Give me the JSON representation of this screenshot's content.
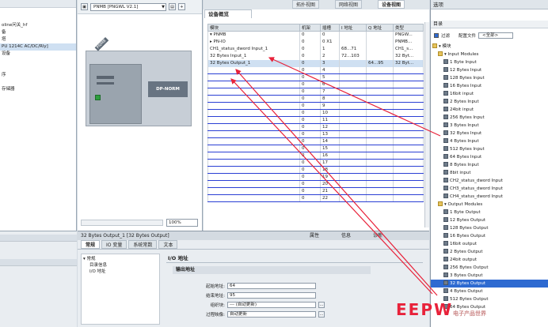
{
  "top_tabs": [
    "拓扑视图",
    "网络视图",
    "设备视图"
  ],
  "catalog_header": "选项",
  "left_tree": {
    "rows": [
      "oline问关_hf",
      "备",
      "塔",
      "PU 1214C AC/DC/Rly]",
      "设备",
      "",
      "",
      "序",
      "",
      "存储器"
    ],
    "selected_index": 3
  },
  "device_view": {
    "device_select": "PNMB [PNGWL V2.1]",
    "module_tag": "PNMB",
    "dp_label": "DP-NORM",
    "zoom": "100%"
  },
  "overview": {
    "title": "设备概览",
    "columns": [
      "模块",
      "机架",
      "插槽",
      "I 地址",
      "Q 地址",
      "类型"
    ],
    "rows": [
      {
        "module": "▾ PNMB",
        "rack": "0",
        "slot": "0",
        "i": "",
        "q": "",
        "type": "PNGW..."
      },
      {
        "module": "  ▸ PN-IO",
        "rack": "0",
        "slot": "0 X1",
        "i": "",
        "q": "",
        "type": "PNMB..."
      },
      {
        "module": "CH1_status_dword Input_1",
        "rack": "0",
        "slot": "1",
        "i": "68...71",
        "q": "",
        "type": "CH1_s..."
      },
      {
        "module": "32 Bytes Input_1",
        "rack": "0",
        "slot": "2",
        "i": "72...103",
        "q": "",
        "type": "32 Byt..."
      },
      {
        "module": "32 Bytes Output_1",
        "rack": "0",
        "slot": "3",
        "i": "",
        "q": "64...95",
        "type": "32 Byt..."
      },
      {
        "module": "",
        "rack": "0",
        "slot": "4",
        "i": "",
        "q": "",
        "type": ""
      },
      {
        "module": "",
        "rack": "0",
        "slot": "5",
        "i": "",
        "q": "",
        "type": ""
      },
      {
        "module": "",
        "rack": "0",
        "slot": "6",
        "i": "",
        "q": "",
        "type": ""
      },
      {
        "module": "",
        "rack": "0",
        "slot": "7",
        "i": "",
        "q": "",
        "type": ""
      },
      {
        "module": "",
        "rack": "0",
        "slot": "8",
        "i": "",
        "q": "",
        "type": ""
      },
      {
        "module": "",
        "rack": "0",
        "slot": "9",
        "i": "",
        "q": "",
        "type": ""
      },
      {
        "module": "",
        "rack": "0",
        "slot": "10",
        "i": "",
        "q": "",
        "type": ""
      },
      {
        "module": "",
        "rack": "0",
        "slot": "11",
        "i": "",
        "q": "",
        "type": ""
      },
      {
        "module": "",
        "rack": "0",
        "slot": "12",
        "i": "",
        "q": "",
        "type": ""
      },
      {
        "module": "",
        "rack": "0",
        "slot": "13",
        "i": "",
        "q": "",
        "type": ""
      },
      {
        "module": "",
        "rack": "0",
        "slot": "14",
        "i": "",
        "q": "",
        "type": ""
      },
      {
        "module": "",
        "rack": "0",
        "slot": "15",
        "i": "",
        "q": "",
        "type": ""
      },
      {
        "module": "",
        "rack": "0",
        "slot": "16",
        "i": "",
        "q": "",
        "type": ""
      },
      {
        "module": "",
        "rack": "0",
        "slot": "17",
        "i": "",
        "q": "",
        "type": ""
      },
      {
        "module": "",
        "rack": "0",
        "slot": "18",
        "i": "",
        "q": "",
        "type": ""
      },
      {
        "module": "",
        "rack": "0",
        "slot": "19",
        "i": "",
        "q": "",
        "type": ""
      },
      {
        "module": "",
        "rack": "0",
        "slot": "20",
        "i": "",
        "q": "",
        "type": ""
      },
      {
        "module": "",
        "rack": "0",
        "slot": "21",
        "i": "",
        "q": "",
        "type": ""
      },
      {
        "module": "",
        "rack": "0",
        "slot": "22",
        "i": "",
        "q": "",
        "type": ""
      }
    ],
    "selected_index": 4
  },
  "properties": {
    "title": "32 Bytes Output_1 [32 Bytes Output]",
    "right_tabs": [
      "属性",
      "信息",
      "诊断"
    ],
    "tabs": [
      "常规",
      "IO 变量",
      "系统常数",
      "文本"
    ],
    "nav": [
      "▾ 常规",
      "目录信息",
      "I/O 地址"
    ],
    "section": "I/O 地址",
    "subsection": "输出地址",
    "fields": [
      {
        "label": "起始地址:",
        "value": "64"
      },
      {
        "label": "结束地址:",
        "value": "95"
      },
      {
        "label": "组织块:",
        "value": "--- (自动更新)"
      },
      {
        "label": "过程映像:",
        "value": "自动更新"
      }
    ]
  },
  "catalog": {
    "section": "目录",
    "filter_label": "过滤",
    "profile_label": "配置文件",
    "profile_value": "<全部>",
    "items": [
      {
        "label": "▾ 模块",
        "folder": true,
        "indent": 0
      },
      {
        "label": "▾ Input Modules",
        "folder": true,
        "indent": 1
      },
      {
        "label": "1 Byte Input",
        "folder": false,
        "indent": 2
      },
      {
        "label": "12 Bytes Input",
        "folder": false,
        "indent": 2
      },
      {
        "label": "128 Bytes Input",
        "folder": false,
        "indent": 2
      },
      {
        "label": "16 Bytes Input",
        "folder": false,
        "indent": 2
      },
      {
        "label": "16bit input",
        "folder": false,
        "indent": 2
      },
      {
        "label": "2 Bytes Input",
        "folder": false,
        "indent": 2
      },
      {
        "label": "24bit input",
        "folder": false,
        "indent": 2
      },
      {
        "label": "256 Bytes Input",
        "folder": false,
        "indent": 2
      },
      {
        "label": "3 Bytes Input",
        "folder": false,
        "indent": 2
      },
      {
        "label": "32 Bytes Input",
        "folder": false,
        "indent": 2
      },
      {
        "label": "4 Bytes Input",
        "folder": false,
        "indent": 2
      },
      {
        "label": "512 Bytes Input",
        "folder": false,
        "indent": 2
      },
      {
        "label": "64 Bytes Input",
        "folder": false,
        "indent": 2
      },
      {
        "label": "8 Bytes Input",
        "folder": false,
        "indent": 2
      },
      {
        "label": "8bit input",
        "folder": false,
        "indent": 2
      },
      {
        "label": "CH2_status_dword Input",
        "folder": false,
        "indent": 2
      },
      {
        "label": "CH3_status_dword Input",
        "folder": false,
        "indent": 2
      },
      {
        "label": "CH4_status_dword Input",
        "folder": false,
        "indent": 2
      },
      {
        "label": "▾ Output Modules",
        "folder": true,
        "indent": 1
      },
      {
        "label": "1 Byte Output",
        "folder": false,
        "indent": 2
      },
      {
        "label": "12 Bytes Output",
        "folder": false,
        "indent": 2
      },
      {
        "label": "128 Bytes Output",
        "folder": false,
        "indent": 2
      },
      {
        "label": "16 Bytes Output",
        "folder": false,
        "indent": 2
      },
      {
        "label": "16bit output",
        "folder": false,
        "indent": 2
      },
      {
        "label": "2 Bytes Output",
        "folder": false,
        "indent": 2
      },
      {
        "label": "24bit output",
        "folder": false,
        "indent": 2
      },
      {
        "label": "256 Bytes Output",
        "folder": false,
        "indent": 2
      },
      {
        "label": "3 Bytes Output",
        "folder": false,
        "indent": 2
      },
      {
        "label": "32 Bytes Output",
        "folder": false,
        "indent": 2,
        "selected": true
      },
      {
        "label": "4 Bytes Output",
        "folder": false,
        "indent": 2
      },
      {
        "label": "512 Bytes Output",
        "folder": false,
        "indent": 2
      },
      {
        "label": "64 Bytes Output",
        "folder": false,
        "indent": 2
      }
    ]
  },
  "watermark": {
    "big": "EEPW",
    "small": "电子产品世界"
  },
  "colors": {
    "annotation_arrow": "#e8223a",
    "selection": "#2e6ad1"
  }
}
